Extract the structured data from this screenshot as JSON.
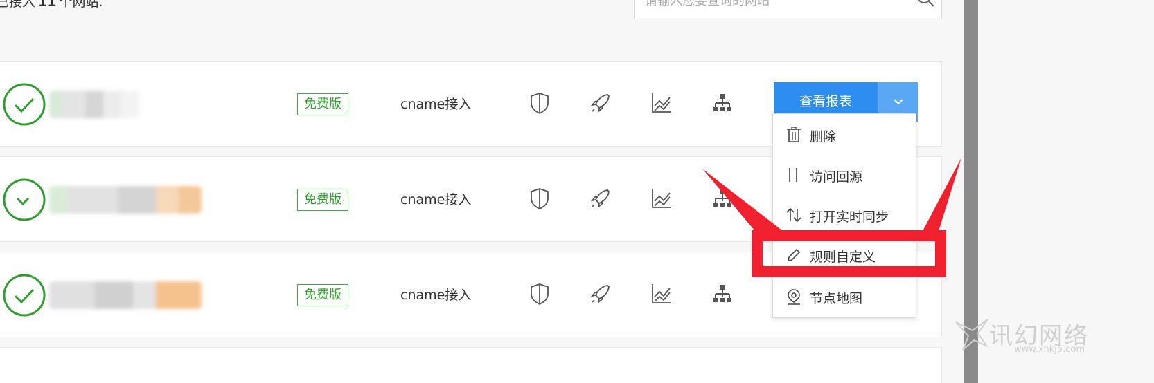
{
  "summary": {
    "prefix": "已接入",
    "count": "11",
    "suffix": "个网站."
  },
  "search": {
    "placeholder": "请输入您要查询的网站"
  },
  "sites": [
    {
      "status": "check-circle-icon",
      "plan": "免费版",
      "access": "cname接入"
    },
    {
      "status": "check-circle-icon",
      "plan": "免费版",
      "access": "cname接入"
    },
    {
      "status": "check-circle-icon",
      "plan": "免费版",
      "access": "cname接入"
    }
  ],
  "operation_icons": [
    "shield-icon",
    "rocket-icon",
    "chart-icon",
    "node-tree-icon"
  ],
  "actions": {
    "report_label": "查看报表",
    "dropdown": [
      {
        "icon": "trash-icon",
        "label": "删除"
      },
      {
        "icon": "origin-icon",
        "label": "访问回源"
      },
      {
        "icon": "sync-icon",
        "label": "打开实时同步"
      },
      {
        "icon": "pencil-icon",
        "label": "规则自定义"
      },
      {
        "icon": "location-pin-icon",
        "label": "节点地图"
      }
    ]
  },
  "colors": {
    "accent": "#2d8cf0",
    "success": "#2f9e2f",
    "highlight": "#f0212f"
  },
  "watermark": {
    "text": "讯幻网络",
    "url": "www.xhkj5.com"
  }
}
